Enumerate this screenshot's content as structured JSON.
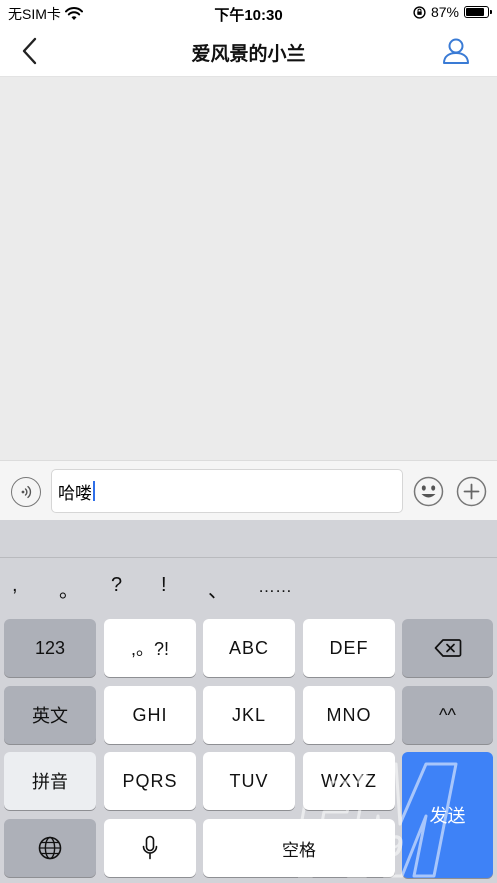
{
  "status_bar": {
    "carrier": "无SIM卡",
    "time": "下午10:30",
    "battery_percent": "87%",
    "battery_level": 0.87
  },
  "nav": {
    "title": "爱风景的小兰",
    "back_icon": "chevron-left-icon",
    "profile_icon": "user-icon"
  },
  "input_bar": {
    "text": "哈喽",
    "voice_icon": "voice-icon",
    "emoji_icon": "smiley-icon",
    "plus_icon": "plus-icon"
  },
  "keyboard": {
    "punctuation": [
      ",",
      "。",
      "?",
      "!",
      "、",
      "……"
    ],
    "keys": {
      "num": "123",
      "punct": ",。?!",
      "abc": "ABC",
      "def": "DEF",
      "english": "英文",
      "ghi": "GHI",
      "jkl": "JKL",
      "mno": "MNO",
      "emoticon": "^^",
      "pinyin": "拼音",
      "pqrs": "PQRS",
      "tuv": "TUV",
      "wxyz": "WXYZ",
      "send": "发送",
      "space": "空格"
    },
    "send_color": "#3e82f7"
  },
  "watermark": {
    "text": "4399"
  }
}
